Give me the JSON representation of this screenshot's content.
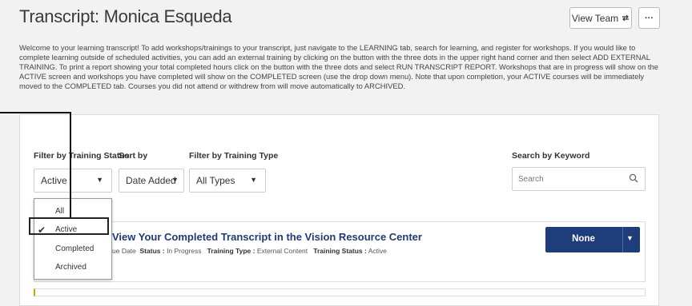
{
  "header": {
    "title": "Transcript: Monica Esqueda",
    "view_team_label": "View Team",
    "more_label": "···"
  },
  "intro": "Welcome to your learning transcript! To add workshops/trainings to your transcript, just navigate to the LEARNING tab, search for learning, and register for workshops. If you would like to complete learning outside of scheduled activities, you can add an external training by clicking on the button with the three dots in the upper right hand corner and then select ADD EXTERNAL TRAINING. To print a report showing your total completed hours click on the button with the three dots and select RUN TRANSCRIPT REPORT. Workshops that are in progress will show on the ACTIVE screen and workshops you have completed will show on the COMPLETED screen (use the drop down menu). Note that upon completion, your ACTIVE courses will be immediately moved to the COMPLETED tab. Courses you did not attend or withdrew from will move automatically to ARCHIVED.",
  "filters": {
    "status_label": "Filter by Training Status",
    "status_value": "Active",
    "sort_label": "Sort by",
    "sort_value": "Date Added",
    "type_label": "Filter by Training Type",
    "type_value": "All Types",
    "search_label": "Search by Keyword",
    "search_placeholder": "Search"
  },
  "status_options": [
    "All",
    "Active",
    "Completed",
    "Archived"
  ],
  "selected_status": "Active",
  "item": {
    "title": "View Your Completed Transcript in the Vision Resource Center",
    "due_fragment": "ue Date",
    "status_label": "Status :",
    "status_value": "In Progress",
    "type_label": "Training Type :",
    "type_value": "External Content",
    "training_status_label": "Training Status :",
    "training_status_value": "Active",
    "action_label": "None"
  },
  "colors": {
    "primary": "#1d3d7b",
    "link": "#1f3a7a",
    "background": "#f2f2f2"
  }
}
